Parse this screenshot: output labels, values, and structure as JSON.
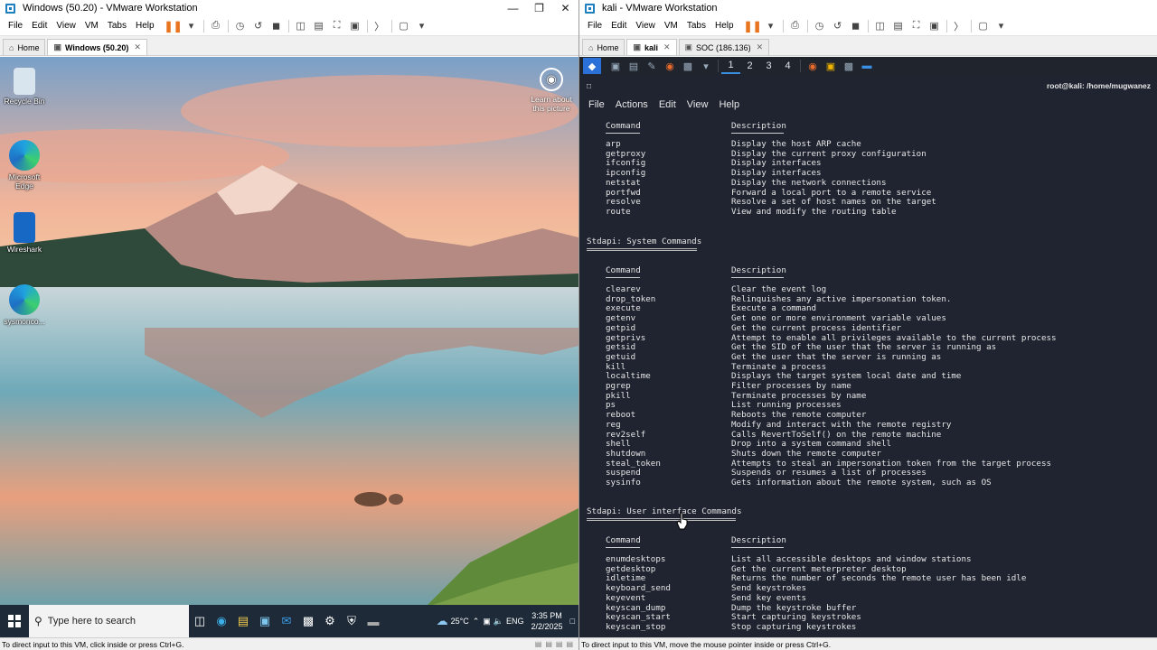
{
  "left_window": {
    "title": "Windows (50.20) - VMware Workstation",
    "menu": [
      "File",
      "Edit",
      "View",
      "VM",
      "Tabs",
      "Help"
    ],
    "tabs": [
      {
        "label": "Home",
        "active": false
      },
      {
        "label": "Windows (50.20)",
        "active": true
      }
    ],
    "status": "To direct input to this VM, click inside or press Ctrl+G."
  },
  "windows_guest": {
    "desktop_icons": [
      {
        "label": "Recycle Bin",
        "icon": "recycle-bin-icon"
      },
      {
        "label": "Microsoft Edge",
        "icon": "edge-icon"
      },
      {
        "label": "Wireshark",
        "icon": "wireshark-icon"
      },
      {
        "label": "sysmonco...",
        "icon": "edge-icon"
      }
    ],
    "learn_label": "Learn about this picture",
    "search_placeholder": "Type here to search",
    "weather": "25°C",
    "lang": "ENG",
    "time": "3:35 PM",
    "date": "2/2/2025"
  },
  "right_window": {
    "title": "kali - VMware Workstation",
    "menu": [
      "File",
      "Edit",
      "View",
      "VM",
      "Tabs",
      "Help"
    ],
    "tabs": [
      {
        "label": "Home",
        "active": false
      },
      {
        "label": "kali",
        "active": true
      },
      {
        "label": "SOC (186.136)",
        "active": false
      }
    ],
    "status": "To direct input to this VM, move the mouse pointer inside or press Ctrl+G."
  },
  "kali": {
    "workspaces": [
      "1",
      "2",
      "3",
      "4"
    ],
    "terminal_title": "root@kali: /home/mugwanez",
    "terminal_menu": [
      "File",
      "Actions",
      "Edit",
      "View",
      "Help"
    ],
    "col_command": "Command",
    "col_description": "Description",
    "network_rows": [
      {
        "cmd": "arp",
        "desc": "Display the host ARP cache"
      },
      {
        "cmd": "getproxy",
        "desc": "Display the current proxy configuration"
      },
      {
        "cmd": "ifconfig",
        "desc": "Display interfaces"
      },
      {
        "cmd": "ipconfig",
        "desc": "Display interfaces"
      },
      {
        "cmd": "netstat",
        "desc": "Display the network connections"
      },
      {
        "cmd": "portfwd",
        "desc": "Forward a local port to a remote service"
      },
      {
        "cmd": "resolve",
        "desc": "Resolve a set of host names on the target"
      },
      {
        "cmd": "route",
        "desc": "View and modify the routing table"
      }
    ],
    "system_heading": "Stdapi: System Commands",
    "system_rows": [
      {
        "cmd": "clearev",
        "desc": "Clear the event log"
      },
      {
        "cmd": "drop_token",
        "desc": "Relinquishes any active impersonation token."
      },
      {
        "cmd": "execute",
        "desc": "Execute a command"
      },
      {
        "cmd": "getenv",
        "desc": "Get one or more environment variable values"
      },
      {
        "cmd": "getpid",
        "desc": "Get the current process identifier"
      },
      {
        "cmd": "getprivs",
        "desc": "Attempt to enable all privileges available to the current process"
      },
      {
        "cmd": "getsid",
        "desc": "Get the SID of the user that the server is running as"
      },
      {
        "cmd": "getuid",
        "desc": "Get the user that the server is running as"
      },
      {
        "cmd": "kill",
        "desc": "Terminate a process"
      },
      {
        "cmd": "localtime",
        "desc": "Displays the target system local date and time"
      },
      {
        "cmd": "pgrep",
        "desc": "Filter processes by name"
      },
      {
        "cmd": "pkill",
        "desc": "Terminate processes by name"
      },
      {
        "cmd": "ps",
        "desc": "List running processes"
      },
      {
        "cmd": "reboot",
        "desc": "Reboots the remote computer"
      },
      {
        "cmd": "reg",
        "desc": "Modify and interact with the remote registry"
      },
      {
        "cmd": "rev2self",
        "desc": "Calls RevertToSelf() on the remote machine"
      },
      {
        "cmd": "shell",
        "desc": "Drop into a system command shell"
      },
      {
        "cmd": "shutdown",
        "desc": "Shuts down the remote computer"
      },
      {
        "cmd": "steal_token",
        "desc": "Attempts to steal an impersonation token from the target process"
      },
      {
        "cmd": "suspend",
        "desc": "Suspends or resumes a list of processes"
      },
      {
        "cmd": "sysinfo",
        "desc": "Gets information about the remote system, such as OS"
      }
    ],
    "ui_heading": "Stdapi: User interface Commands",
    "ui_rows": [
      {
        "cmd": "enumdesktops",
        "desc": "List all accessible desktops and window stations"
      },
      {
        "cmd": "getdesktop",
        "desc": "Get the current meterpreter desktop"
      },
      {
        "cmd": "idletime",
        "desc": "Returns the number of seconds the remote user has been idle"
      },
      {
        "cmd": "keyboard_send",
        "desc": "Send keystrokes"
      },
      {
        "cmd": "keyevent",
        "desc": "Send key events"
      },
      {
        "cmd": "keyscan_dump",
        "desc": "Dump the keystroke buffer"
      },
      {
        "cmd": "keyscan_start",
        "desc": "Start capturing keystrokes"
      },
      {
        "cmd": "keyscan_stop",
        "desc": "Stop capturing keystrokes"
      }
    ]
  }
}
